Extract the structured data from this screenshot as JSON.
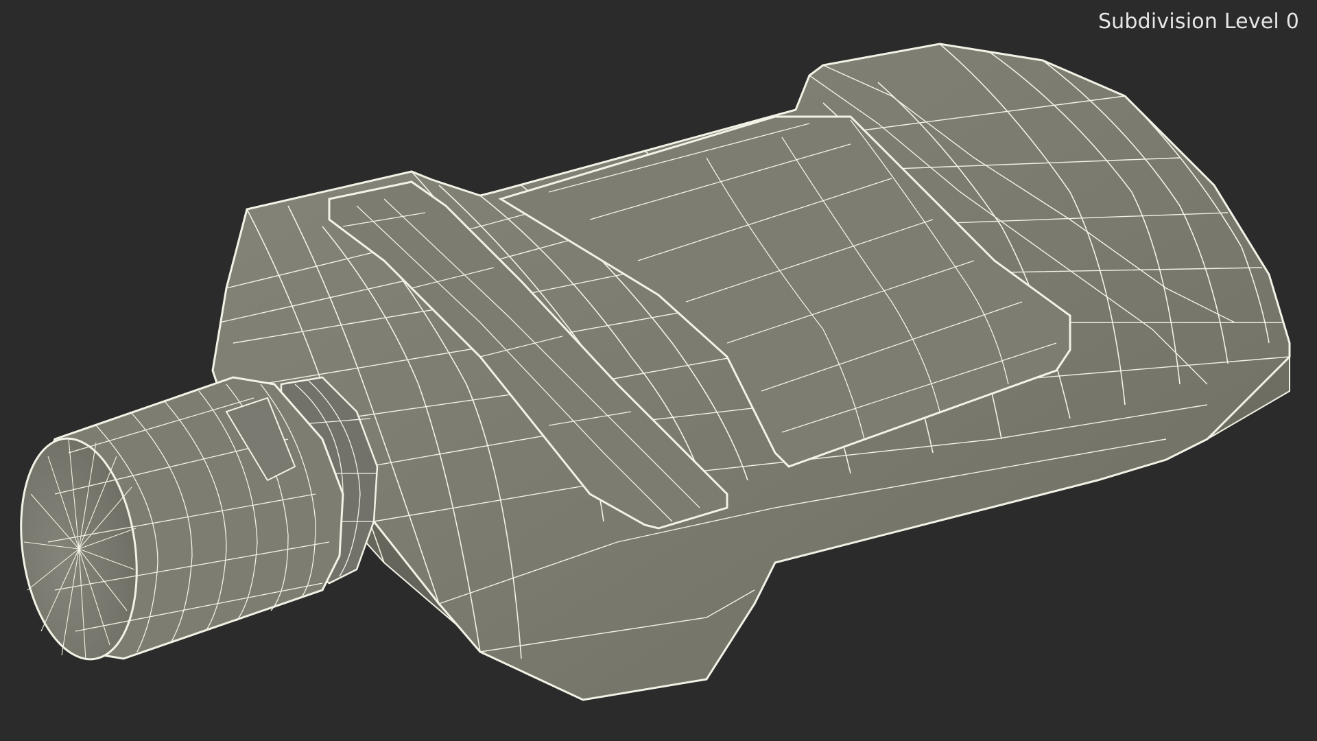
{
  "viewport": {
    "label": "Subdivision Level 0",
    "background_color": "#2b2b2b",
    "label_color": "#e6e6e6"
  },
  "model": {
    "render_mode": "wireframe-on-shaded",
    "surface_color": "#7b7b6e",
    "wire_color": "#f2f2e6"
  }
}
